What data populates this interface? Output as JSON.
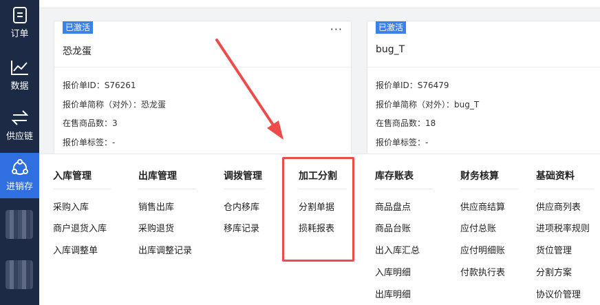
{
  "sidebar": {
    "items": [
      {
        "label": "订单",
        "icon": "order-icon"
      },
      {
        "label": "数据",
        "icon": "chart-line-icon"
      },
      {
        "label": "供应链",
        "icon": "exchange-icon"
      },
      {
        "label": "进销存",
        "icon": "inventory-icon",
        "active": true
      }
    ]
  },
  "cards": [
    {
      "badge": "已激活",
      "title": "恐龙蛋",
      "more": "···",
      "fields": [
        "报价单ID：S76261",
        "报价单简称（对外）：恐龙蛋",
        "在售商品数：3",
        "报价单标签：-"
      ]
    },
    {
      "badge": "已激活",
      "title": "bug_T",
      "fields": [
        "报价单ID：S76479",
        "报价单简称（对外）：bug_T",
        "在售商品数：18",
        "报价单标签：-"
      ]
    }
  ],
  "menu": {
    "columns": [
      {
        "heading": "入库管理",
        "items": [
          "采购入库",
          "商户退货入库",
          "入库调整单"
        ]
      },
      {
        "heading": "出库管理",
        "items": [
          "销售出库",
          "采购退货",
          "出库调整记录"
        ]
      },
      {
        "heading": "调拨管理",
        "items": [
          "仓内移库",
          "移库记录"
        ]
      },
      {
        "heading": "加工分割",
        "items": [
          "分割单据",
          "损耗报表"
        ]
      },
      {
        "heading": "库存账表",
        "items": [
          "商品盘点",
          "商品台账",
          "出入库汇总",
          "入库明细",
          "出库明细"
        ]
      },
      {
        "heading": "财务核算",
        "items": [
          "供应商结算",
          "应付总账",
          "应付明细账",
          "付款执行表"
        ]
      },
      {
        "heading": "基础资料",
        "items": [
          "供应商列表",
          "进项税率规则",
          "货位管理",
          "分割方案",
          "协议价管理"
        ]
      }
    ]
  },
  "colors": {
    "sidebar_bg": "#1c2a45",
    "active_bg": "#2f6fe0",
    "badge_bg": "#3b82e8",
    "highlight": "#ee4b4b"
  }
}
